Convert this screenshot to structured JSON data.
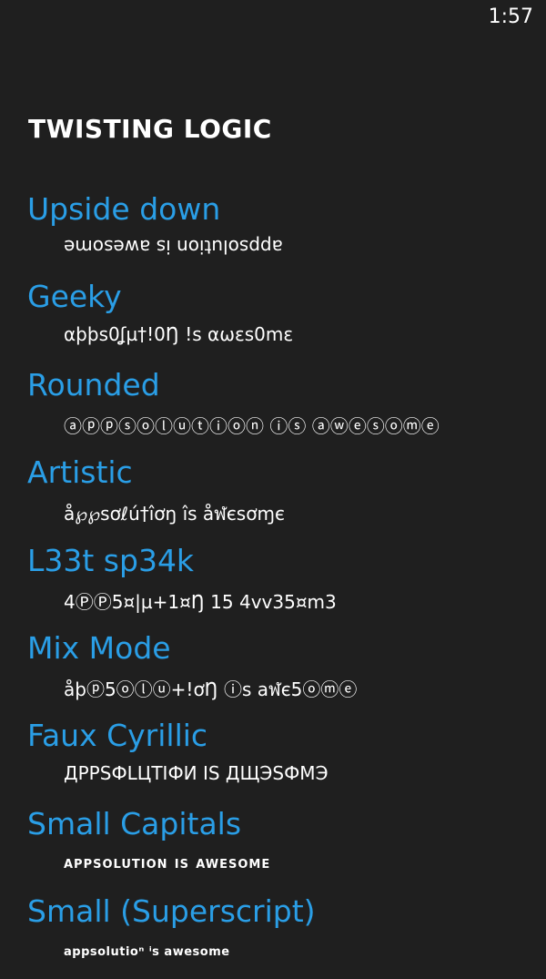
{
  "status_bar": {
    "time": "1:57"
  },
  "app": {
    "title": "TWISTING LOGIC"
  },
  "styles": [
    {
      "name": "Upside down",
      "sample": "appsolution is awesome"
    },
    {
      "name": "Geeky",
      "sample": "αþþs0ʆµ†!0Ŋ !s αωεs0mε"
    },
    {
      "name": "Rounded",
      "sample": "ⓐⓟⓟⓢⓞⓛⓤⓣⓘⓞⓝ ⓘⓢ ⓐⓦⓔⓢⓞⓜⓔ"
    },
    {
      "name": "Artistic",
      "sample": "å℘℘ѕơℓú†îơŋ îѕ åฬєѕơɱє"
    },
    {
      "name": "L33t sp34k",
      "sample": "4ⓅⓅ5¤|µ+1¤Ŋ 15 4vv35¤m3"
    },
    {
      "name": "Mix Mode",
      "sample": "åþⓟ5ⓞⓛⓤ+!ơŊ ⓘs aฬє5ⓞⓜⓔ"
    },
    {
      "name": "Faux Cyrillic",
      "sample": "ДРРЅФLЦТІФИ ІЅ ДЩЭЅФМЭ"
    },
    {
      "name": "Small Capitals",
      "sample": "appsolution is awesome"
    },
    {
      "name": "Small (Superscript)",
      "sample": "appsolutioⁿ ⁱs awesome"
    }
  ],
  "colors": {
    "background": "#1f1f1f",
    "accent": "#2a9ee6",
    "text": "#ffffff"
  }
}
